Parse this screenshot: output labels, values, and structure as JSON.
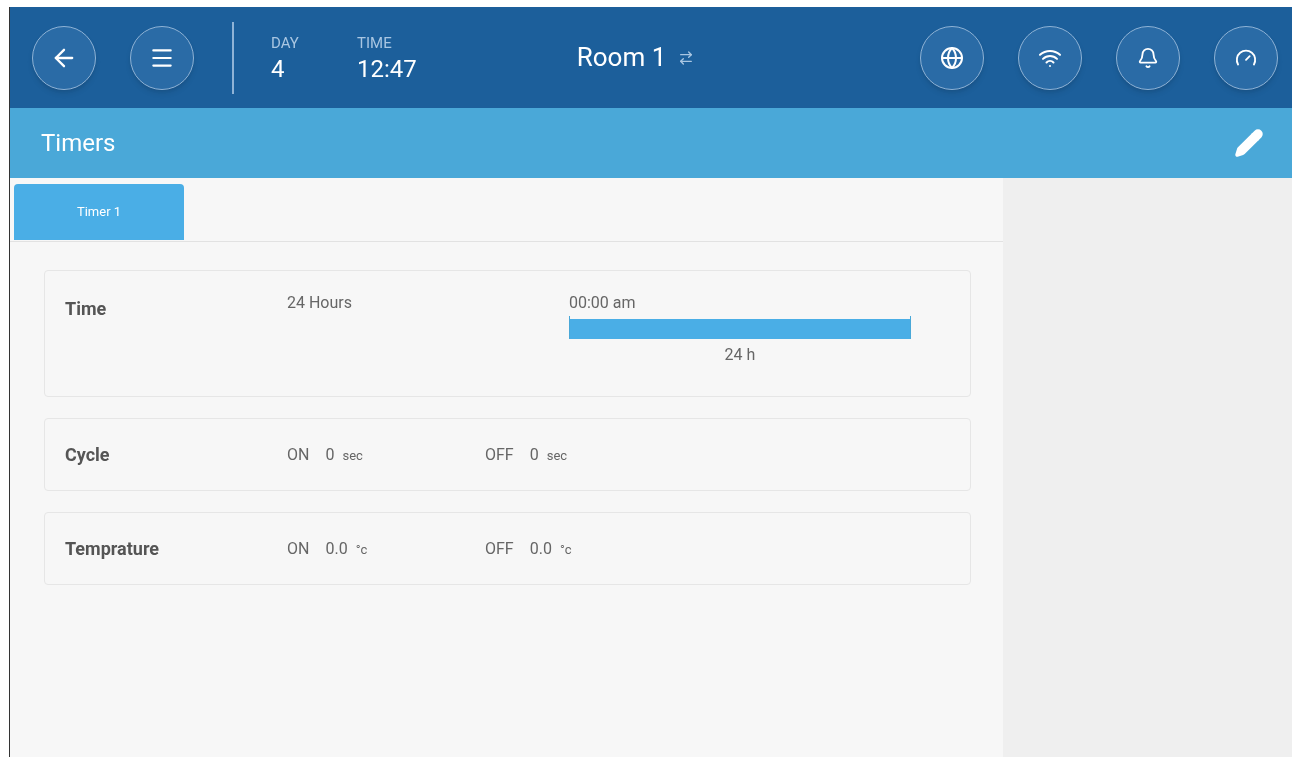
{
  "header": {
    "day_label": "DAY",
    "day": "4",
    "time_label": "TIME",
    "time": "12:47",
    "room": "Room 1"
  },
  "title": "Timers",
  "tabs": [
    {
      "label": "Timer 1",
      "selected": true
    }
  ],
  "rows": [
    {
      "kind": "time",
      "label": "Time",
      "duration": "24 Hours",
      "start": "00:00 am",
      "span": "24 h"
    },
    {
      "kind": "onoff",
      "label": "Cycle",
      "on_label": "ON",
      "on_value": "0",
      "on_unit": "sec",
      "off_label": "OFF",
      "off_value": "0",
      "off_unit": "sec"
    },
    {
      "kind": "onoff",
      "label": "Temprature",
      "on_label": "ON",
      "on_value": "0.0",
      "on_unit": "°c",
      "off_label": "OFF",
      "off_value": "0.0",
      "off_unit": "°c"
    }
  ]
}
